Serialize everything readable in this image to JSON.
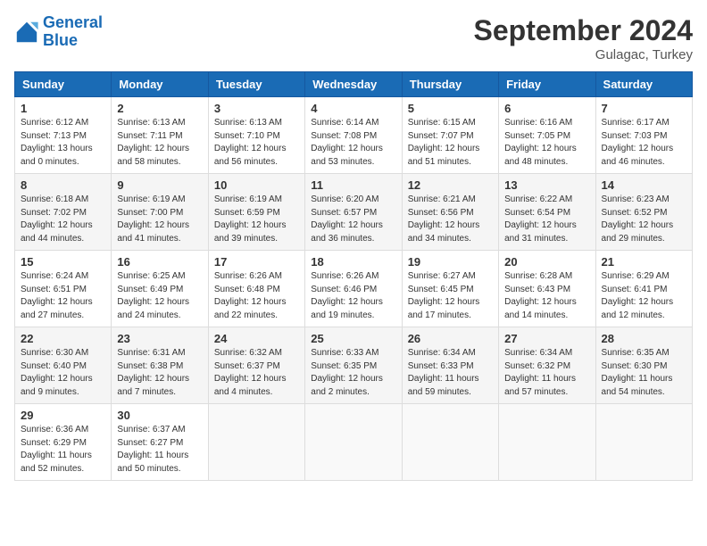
{
  "header": {
    "logo_line1": "General",
    "logo_line2": "Blue",
    "month": "September 2024",
    "location": "Gulagac, Turkey"
  },
  "weekdays": [
    "Sunday",
    "Monday",
    "Tuesday",
    "Wednesday",
    "Thursday",
    "Friday",
    "Saturday"
  ],
  "weeks": [
    [
      {
        "day": "1",
        "info": "Sunrise: 6:12 AM\nSunset: 7:13 PM\nDaylight: 13 hours\nand 0 minutes."
      },
      {
        "day": "2",
        "info": "Sunrise: 6:13 AM\nSunset: 7:11 PM\nDaylight: 12 hours\nand 58 minutes."
      },
      {
        "day": "3",
        "info": "Sunrise: 6:13 AM\nSunset: 7:10 PM\nDaylight: 12 hours\nand 56 minutes."
      },
      {
        "day": "4",
        "info": "Sunrise: 6:14 AM\nSunset: 7:08 PM\nDaylight: 12 hours\nand 53 minutes."
      },
      {
        "day": "5",
        "info": "Sunrise: 6:15 AM\nSunset: 7:07 PM\nDaylight: 12 hours\nand 51 minutes."
      },
      {
        "day": "6",
        "info": "Sunrise: 6:16 AM\nSunset: 7:05 PM\nDaylight: 12 hours\nand 48 minutes."
      },
      {
        "day": "7",
        "info": "Sunrise: 6:17 AM\nSunset: 7:03 PM\nDaylight: 12 hours\nand 46 minutes."
      }
    ],
    [
      {
        "day": "8",
        "info": "Sunrise: 6:18 AM\nSunset: 7:02 PM\nDaylight: 12 hours\nand 44 minutes."
      },
      {
        "day": "9",
        "info": "Sunrise: 6:19 AM\nSunset: 7:00 PM\nDaylight: 12 hours\nand 41 minutes."
      },
      {
        "day": "10",
        "info": "Sunrise: 6:19 AM\nSunset: 6:59 PM\nDaylight: 12 hours\nand 39 minutes."
      },
      {
        "day": "11",
        "info": "Sunrise: 6:20 AM\nSunset: 6:57 PM\nDaylight: 12 hours\nand 36 minutes."
      },
      {
        "day": "12",
        "info": "Sunrise: 6:21 AM\nSunset: 6:56 PM\nDaylight: 12 hours\nand 34 minutes."
      },
      {
        "day": "13",
        "info": "Sunrise: 6:22 AM\nSunset: 6:54 PM\nDaylight: 12 hours\nand 31 minutes."
      },
      {
        "day": "14",
        "info": "Sunrise: 6:23 AM\nSunset: 6:52 PM\nDaylight: 12 hours\nand 29 minutes."
      }
    ],
    [
      {
        "day": "15",
        "info": "Sunrise: 6:24 AM\nSunset: 6:51 PM\nDaylight: 12 hours\nand 27 minutes."
      },
      {
        "day": "16",
        "info": "Sunrise: 6:25 AM\nSunset: 6:49 PM\nDaylight: 12 hours\nand 24 minutes."
      },
      {
        "day": "17",
        "info": "Sunrise: 6:26 AM\nSunset: 6:48 PM\nDaylight: 12 hours\nand 22 minutes."
      },
      {
        "day": "18",
        "info": "Sunrise: 6:26 AM\nSunset: 6:46 PM\nDaylight: 12 hours\nand 19 minutes."
      },
      {
        "day": "19",
        "info": "Sunrise: 6:27 AM\nSunset: 6:45 PM\nDaylight: 12 hours\nand 17 minutes."
      },
      {
        "day": "20",
        "info": "Sunrise: 6:28 AM\nSunset: 6:43 PM\nDaylight: 12 hours\nand 14 minutes."
      },
      {
        "day": "21",
        "info": "Sunrise: 6:29 AM\nSunset: 6:41 PM\nDaylight: 12 hours\nand 12 minutes."
      }
    ],
    [
      {
        "day": "22",
        "info": "Sunrise: 6:30 AM\nSunset: 6:40 PM\nDaylight: 12 hours\nand 9 minutes."
      },
      {
        "day": "23",
        "info": "Sunrise: 6:31 AM\nSunset: 6:38 PM\nDaylight: 12 hours\nand 7 minutes."
      },
      {
        "day": "24",
        "info": "Sunrise: 6:32 AM\nSunset: 6:37 PM\nDaylight: 12 hours\nand 4 minutes."
      },
      {
        "day": "25",
        "info": "Sunrise: 6:33 AM\nSunset: 6:35 PM\nDaylight: 12 hours\nand 2 minutes."
      },
      {
        "day": "26",
        "info": "Sunrise: 6:34 AM\nSunset: 6:33 PM\nDaylight: 11 hours\nand 59 minutes."
      },
      {
        "day": "27",
        "info": "Sunrise: 6:34 AM\nSunset: 6:32 PM\nDaylight: 11 hours\nand 57 minutes."
      },
      {
        "day": "28",
        "info": "Sunrise: 6:35 AM\nSunset: 6:30 PM\nDaylight: 11 hours\nand 54 minutes."
      }
    ],
    [
      {
        "day": "29",
        "info": "Sunrise: 6:36 AM\nSunset: 6:29 PM\nDaylight: 11 hours\nand 52 minutes."
      },
      {
        "day": "30",
        "info": "Sunrise: 6:37 AM\nSunset: 6:27 PM\nDaylight: 11 hours\nand 50 minutes."
      },
      {
        "day": "",
        "info": ""
      },
      {
        "day": "",
        "info": ""
      },
      {
        "day": "",
        "info": ""
      },
      {
        "day": "",
        "info": ""
      },
      {
        "day": "",
        "info": ""
      }
    ]
  ]
}
